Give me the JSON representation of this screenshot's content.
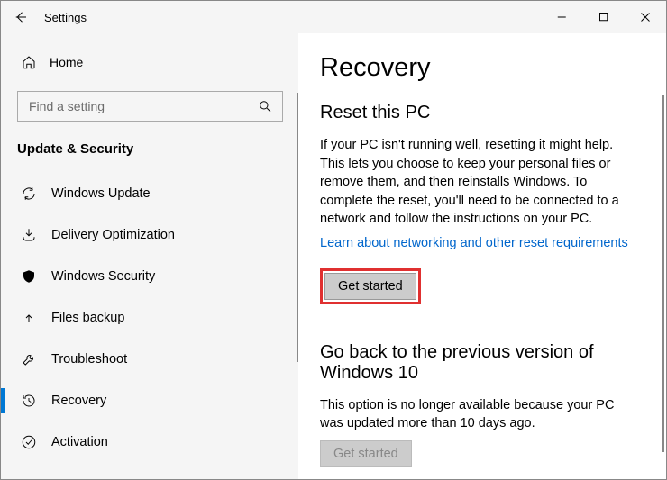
{
  "titlebar": {
    "title": "Settings"
  },
  "sidebar": {
    "home_label": "Home",
    "search_placeholder": "Find a setting",
    "group_title": "Update & Security",
    "items": [
      {
        "label": "Windows Update"
      },
      {
        "label": "Delivery Optimization"
      },
      {
        "label": "Windows Security"
      },
      {
        "label": "Files backup"
      },
      {
        "label": "Troubleshoot"
      },
      {
        "label": "Recovery"
      },
      {
        "label": "Activation"
      }
    ]
  },
  "content": {
    "page_title": "Recovery",
    "reset": {
      "heading": "Reset this PC",
      "body": "If your PC isn't running well, resetting it might help. This lets you choose to keep your personal files or remove them, and then reinstalls Windows. To complete the reset, you'll need to be connected to a network and follow the instructions on your PC.",
      "link": "Learn about networking and other reset requirements",
      "button": "Get started"
    },
    "goback": {
      "heading": "Go back to the previous version of Windows 10",
      "body": "This option is no longer available because your PC was updated more than 10 days ago.",
      "button": "Get started"
    }
  }
}
